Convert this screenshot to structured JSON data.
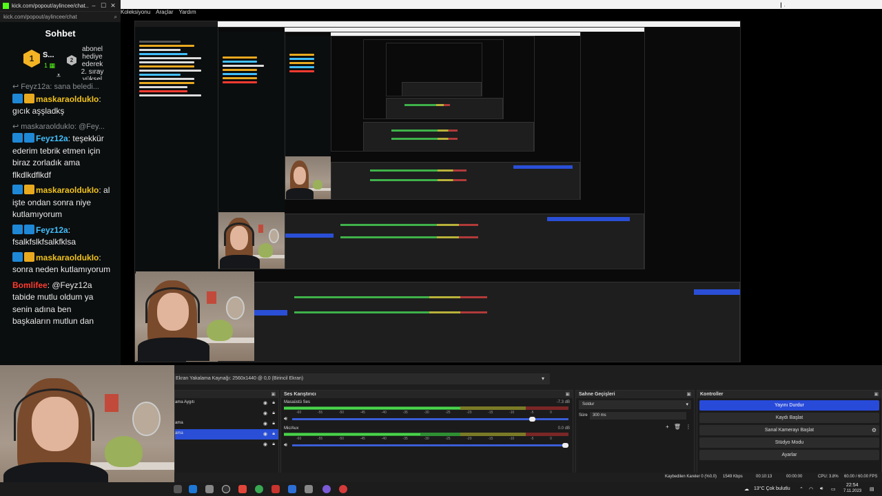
{
  "chat_window": {
    "title": "kick.com/popout/aylincee/chat...",
    "url": "kick.com/popout/aylincee/chat",
    "header": "Sohbet",
    "pinned": {
      "gold_initial": "1",
      "gold_name": "S...",
      "silver_initial": "2",
      "text": "abonel hediye ederek 2. sıray yüksel"
    },
    "messages": [
      {
        "reply_to": "Feyz12a: sana beledi...",
        "user": "maskaraoldukIo",
        "badge": "crown",
        "color": "green",
        "text": "gıcık aşşladkş"
      },
      {
        "reply_to": "maskaraoldukIo: @Fey...",
        "user": "Feyz12a",
        "badge": "star",
        "color": "blue",
        "text": "teşekkür ederim tebrik etmen için biraz zorladık ama flkdlkdflkdf"
      },
      {
        "reply_to": "",
        "user": "maskaraoldukIo",
        "badge": "crown",
        "color": "green",
        "text": "al işte ondan sonra niye kutlamıyorum"
      },
      {
        "reply_to": "",
        "user": "Feyz12a",
        "badge": "star",
        "color": "blue",
        "text": "fsalkfslkfsalkfklsa"
      },
      {
        "reply_to": "",
        "user": "maskaraoldukIo",
        "badge": "crown",
        "color": "green",
        "text": "sonra neden kutlamıyorum"
      },
      {
        "reply_to": "",
        "user": "Bomlifee",
        "badge": "",
        "color": "red",
        "text": "@Feyz12a tabide mutlu oldum ya senin adına ben başkaların mutlun dan"
      }
    ]
  },
  "obs": {
    "menu": [
      "Koleksiyonu",
      "Araçlar",
      "Yardım"
    ],
    "source_bar_label": "Ekran Yakalama Kaynağı: 2560x1440 @ 0,0 (Birincil Ekran)",
    "sources_partial": [
      "ama Aygıtı",
      "",
      "ama",
      "ama",
      ""
    ],
    "mixer": {
      "title": "Ses Karıştırıcı",
      "tracks": [
        {
          "name": "Masaüstü Ses",
          "db": "-7.3 dB",
          "level": 0.62,
          "volume": 0.88
        },
        {
          "name": "Mic/Aux",
          "db": "0.0 dB",
          "level": 0.48,
          "volume": 1.0
        }
      ],
      "ticks": [
        "-60",
        "-55",
        "-50",
        "-45",
        "-40",
        "-35",
        "-30",
        "-25",
        "-20",
        "-15",
        "-10",
        "-5",
        "0"
      ]
    },
    "transitions": {
      "title": "Sahne Geçişleri",
      "selected": "Soldur",
      "duration_label": "Süre",
      "duration": "300 ms"
    },
    "controls": {
      "title": "Kontroller",
      "buttons": [
        "Yayını Durdur",
        "Kaydı Başlat",
        "Sanal Kamerayı Başlat",
        "Stüdyo Modu",
        "Ayarlar"
      ]
    },
    "status": {
      "dropped": "Kaybedilen Kareler 0 (%0.0)",
      "bitrate": "1549 Kbps",
      "live_time": "00:10:13",
      "rec_time": "00:00:00",
      "cpu": "CPU: 3.8%",
      "fps": "60.00 / 60.00 FPS"
    }
  },
  "taskbar": {
    "weather": "13°C  Çok bulutlu",
    "time": "22:54",
    "date": "7.11.2023"
  },
  "colors": {
    "obs_blue": "#284ad9",
    "kick_green": "#53fc18",
    "dock_bg": "#1e1e1e"
  }
}
